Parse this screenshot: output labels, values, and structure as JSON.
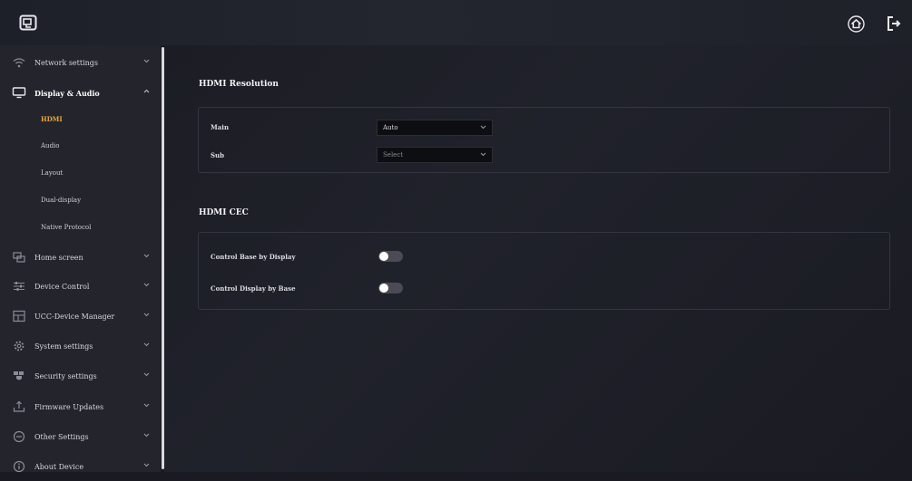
{
  "header": {
    "logo_icon": "screen-share-icon",
    "home_icon": "home-icon",
    "logout_icon": "logout-icon"
  },
  "sidebar": {
    "items": [
      {
        "label": "Network settings",
        "icon": "wifi-icon"
      },
      {
        "label": "Display & Audio",
        "icon": "monitor-icon",
        "expanded": true,
        "children": [
          "HDMI",
          "Audio",
          "Layout",
          "Dual-display",
          "Native Protocol"
        ],
        "selected_child": "HDMI"
      },
      {
        "label": "Home screen",
        "icon": "home-screen-icon"
      },
      {
        "label": "Device Control",
        "icon": "sliders-icon"
      },
      {
        "label": "UCC-Device Manager",
        "icon": "device-manager-icon"
      },
      {
        "label": "System settings",
        "icon": "gear-icon"
      },
      {
        "label": "Security settings",
        "icon": "shield-icon"
      },
      {
        "label": "Firmware Updates",
        "icon": "upload-icon"
      },
      {
        "label": "Other Settings",
        "icon": "more-icon"
      },
      {
        "label": "About Device",
        "icon": "info-icon"
      }
    ]
  },
  "main": {
    "hdmi_resolution": {
      "title": "HDMI Resolution",
      "rows": [
        {
          "label": "Main",
          "value": "Auto",
          "placeholder": false
        },
        {
          "label": "Sub",
          "value": "Select",
          "placeholder": true
        }
      ]
    },
    "hdmi_cec": {
      "title": "HDMI CEC",
      "rows": [
        {
          "label": "Control Base by Display",
          "on": false
        },
        {
          "label": "Control Display by Base",
          "on": false
        }
      ]
    }
  },
  "colors": {
    "accent": "#e6a93c",
    "background": "#1a1b22",
    "sidebar": "#23242c"
  }
}
